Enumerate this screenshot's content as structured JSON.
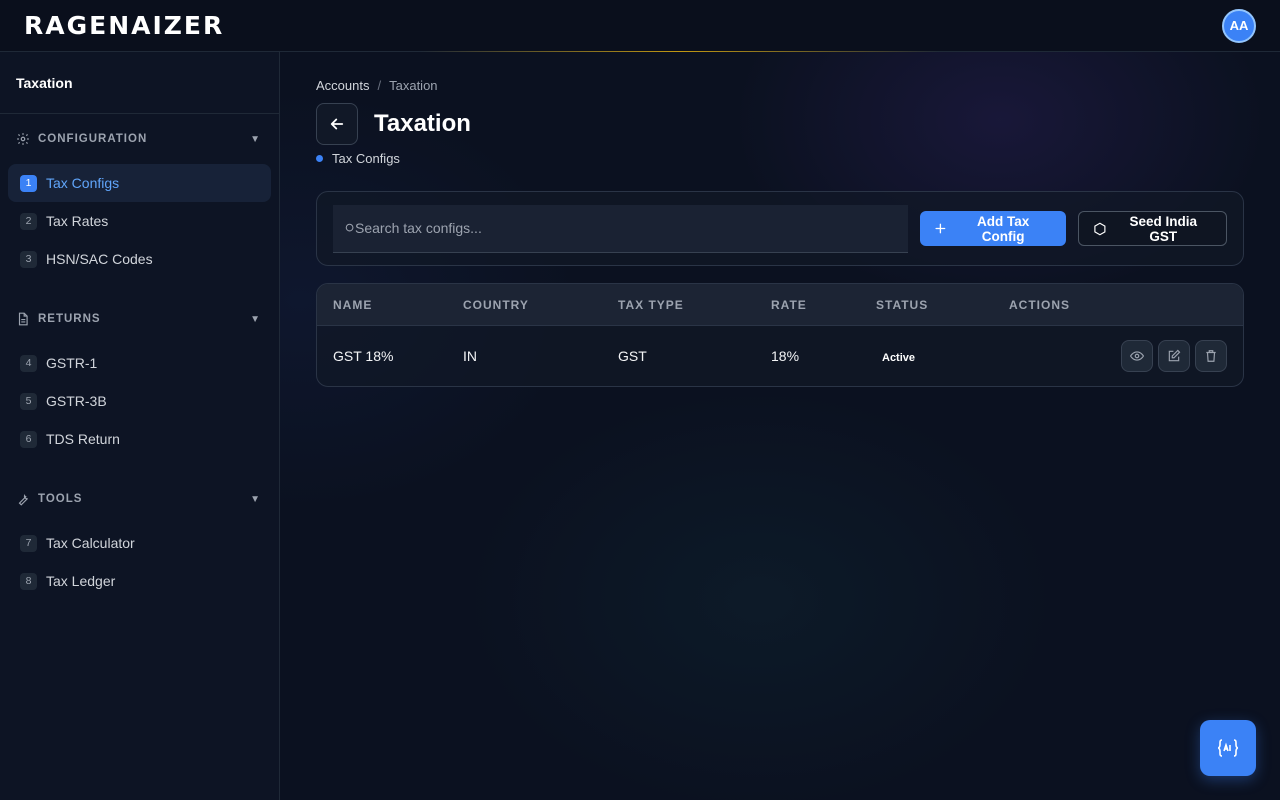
{
  "app": {
    "logo": "RAGENAIZER",
    "avatar_initials": "AA"
  },
  "sidebar": {
    "title": "Taxation",
    "sections": [
      {
        "label": "CONFIGURATION",
        "icon": "gear-icon",
        "items": [
          {
            "num": "1",
            "label": "Tax Configs",
            "active": true
          },
          {
            "num": "2",
            "label": "Tax Rates"
          },
          {
            "num": "3",
            "label": "HSN/SAC Codes"
          }
        ]
      },
      {
        "label": "RETURNS",
        "icon": "document-icon",
        "items": [
          {
            "num": "4",
            "label": "GSTR-1"
          },
          {
            "num": "5",
            "label": "GSTR-3B"
          },
          {
            "num": "6",
            "label": "TDS Return"
          }
        ]
      },
      {
        "label": "TOOLS",
        "icon": "wrench-icon",
        "items": [
          {
            "num": "7",
            "label": "Tax Calculator"
          },
          {
            "num": "8",
            "label": "Tax Ledger"
          }
        ]
      }
    ]
  },
  "breadcrumb": {
    "root": "Accounts",
    "separator": "/",
    "current": "Taxation"
  },
  "page": {
    "title": "Taxation",
    "subtitle": "Tax Configs"
  },
  "toolbar": {
    "search_placeholder": "Search tax configs...",
    "search_value": "",
    "add_label": "Add Tax Config",
    "seed_label": "Seed India GST"
  },
  "table": {
    "headers": [
      "NAME",
      "COUNTRY",
      "TAX TYPE",
      "RATE",
      "STATUS",
      "ACTIONS"
    ],
    "rows": [
      {
        "name": "GST 18%",
        "country": "IN",
        "tax_type": "GST",
        "rate": "18%",
        "status": "Active"
      }
    ]
  },
  "colors": {
    "accent": "#3b82f6",
    "background": "#0b1120",
    "sidebar": "#0d1424"
  },
  "icons": [
    "gear-icon",
    "document-icon",
    "wrench-icon",
    "arrow-left-icon",
    "search-icon",
    "plus-icon",
    "hexagon-icon",
    "eye-icon",
    "edit-icon",
    "trash-icon",
    "assistant-icon"
  ]
}
